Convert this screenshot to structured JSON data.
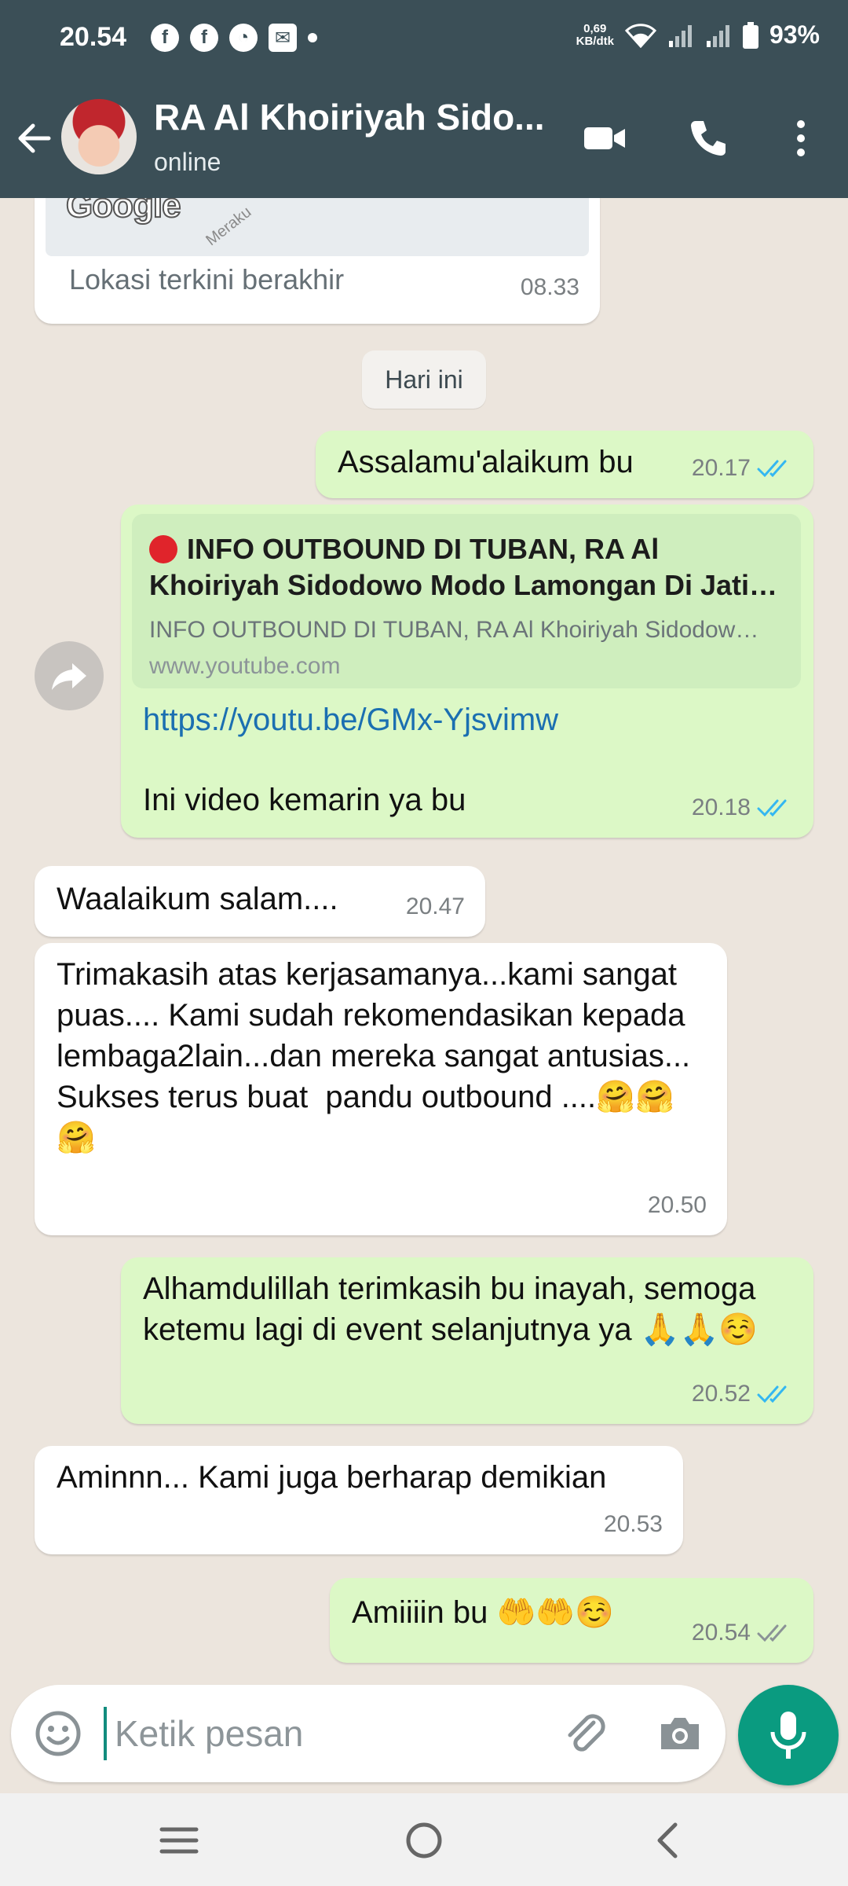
{
  "status_bar": {
    "time": "20.54",
    "notifications": [
      "facebook-icon",
      "facebook-icon",
      "speedometer-icon",
      "mail-icon",
      "dot"
    ],
    "speed_value": "0,69",
    "speed_unit": "KB/dtk",
    "battery": "93%"
  },
  "header": {
    "title": "RA Al Khoiriyah Sido...",
    "subtitle": "online",
    "color": "#3b4f57"
  },
  "messages": {
    "location": {
      "map_brand": "Google",
      "map_street": "Meraku",
      "text": "Lokasi terkini berakhir",
      "time": "08.33"
    },
    "date_divider": "Hari ini",
    "m1": {
      "text": "Assalamu'alaikum bu",
      "time": "20.17",
      "status": "read"
    },
    "m2": {
      "preview_title": "INFO OUTBOUND DI TUBAN, RA Al Khoiriyah Sidodowo Modo Lamongan Di Jati…",
      "preview_desc": "INFO OUTBOUND DI TUBAN, RA Al Khoiriyah Sidodow…",
      "preview_domain": "www.youtube.com",
      "link": "https://youtu.be/GMx-Yjsvimw",
      "text": "Ini video kemarin ya bu",
      "time": "20.18",
      "status": "read"
    },
    "m3": {
      "text": "Waalaikum salam....",
      "time": "20.47"
    },
    "m4": {
      "text": "Trimakasih atas kerjasamanya...kami sangat puas.... Kami sudah rekomendasikan kepada lembaga2lain...dan mereka sangat antusias...  Sukses terus buat  pandu outbound ....🤗🤗🤗",
      "time": "20.50"
    },
    "m5": {
      "text": "Alhamdulillah terimkasih bu inayah, semoga ketemu lagi di event selanjutnya ya 🙏🙏☺️",
      "time": "20.52",
      "status": "read"
    },
    "m6": {
      "text": "Aminnn... Kami juga berharap demikian",
      "time": "20.53"
    },
    "m7": {
      "text": "Amiiiin bu 🤲🤲☺️",
      "time": "20.54",
      "status": "delivered"
    }
  },
  "composer": {
    "placeholder": "Ketik pesan"
  },
  "colors": {
    "incoming_bubble": "#ffffff",
    "outgoing_bubble": "#dcf8c6",
    "read_tick": "#34b7f1",
    "accent": "#0a9b80"
  }
}
